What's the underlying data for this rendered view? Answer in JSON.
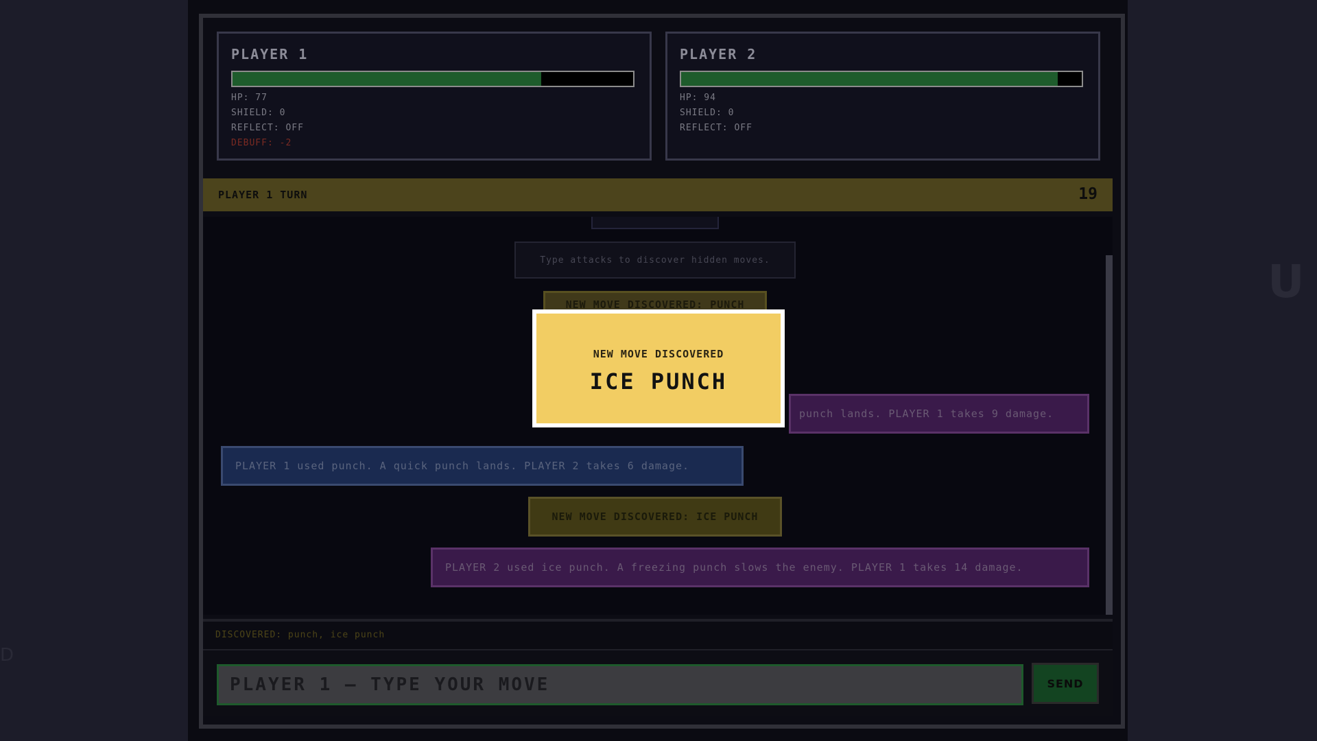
{
  "players": [
    {
      "name": "PLAYER 1",
      "hp": 77,
      "hp_max": 100,
      "stats": [
        "HP: 77",
        "SHIELD: 0",
        "REFLECT: OFF"
      ],
      "debuff": "DEBUFF: -2"
    },
    {
      "name": "PLAYER 2",
      "hp": 94,
      "hp_max": 100,
      "stats": [
        "HP: 94",
        "SHIELD: 0",
        "REFLECT: OFF"
      ]
    }
  ],
  "turn": {
    "label": "PLAYER 1 TURN",
    "counter": "19"
  },
  "log": {
    "hint": "Type attacks to discover hidden moves.",
    "discovered_punch": "NEW MOVE DISCOVERED: PUNCH",
    "p2_punch": "punch lands. PLAYER 1 takes 9 damage.",
    "p1_punch": "PLAYER 1 used punch. A quick punch lands. PLAYER 2 takes 6 damage.",
    "discovered_ice": "NEW MOVE DISCOVERED: ICE PUNCH",
    "p2_ice": "PLAYER 2 used ice punch. A freezing punch slows the enemy. PLAYER 1 takes 14 damage."
  },
  "discovered": "DISCOVERED: punch, ice punch",
  "input": {
    "placeholder": "PLAYER 1 — TYPE YOUR MOVE",
    "value": ""
  },
  "send_label": "SEND",
  "modal": {
    "subtitle": "NEW MOVE DISCOVERED",
    "title": "ICE PUNCH"
  },
  "side_glyphs": {
    "right": "U",
    "left": "D"
  },
  "colors": {
    "hp_fill": "#1e5c2c",
    "turn_bar": "#4c441c",
    "modal_bg": "#f2cd63",
    "p1_msg": "#1a2a50",
    "p2_msg": "#3a1a4a"
  }
}
